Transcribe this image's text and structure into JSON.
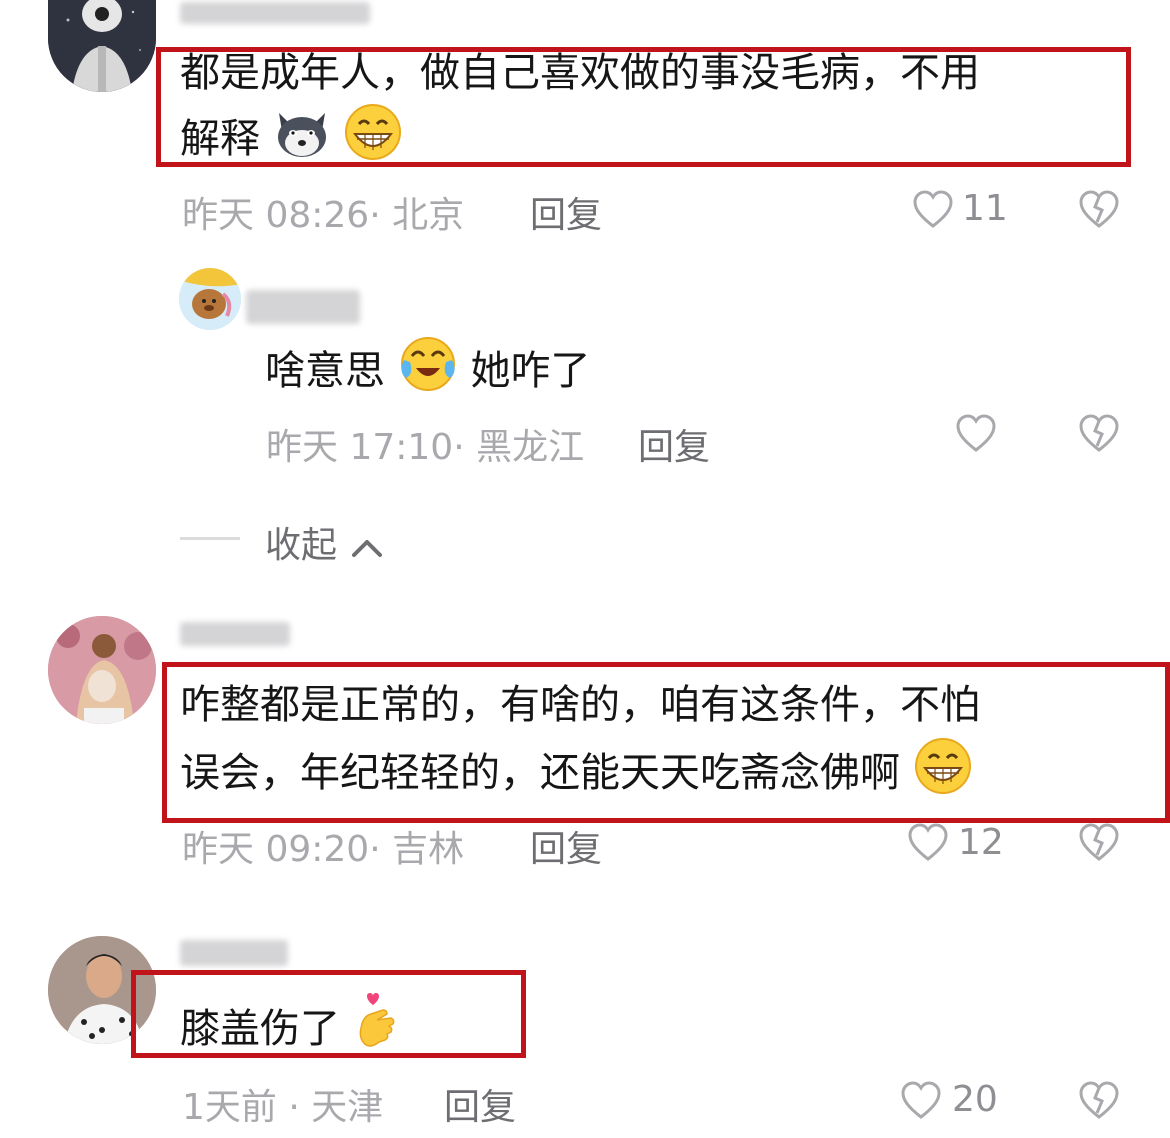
{
  "comments": [
    {
      "text_line1": "都是成年人，做自己喜欢做的事没毛病，不用",
      "text_line2": "解释",
      "time": "昨天 08:26",
      "location": "北京",
      "reply_label": "回复",
      "likes": "11",
      "emojis": [
        "husky-emoji",
        "grin-emoji"
      ]
    },
    {
      "is_reply": true,
      "text_part1": "啥意思",
      "text_part2": "她咋了",
      "time": "昨天 17:10",
      "location": "黑龙江",
      "reply_label": "回复",
      "likes": "",
      "emojis": [
        "tears-of-joy-emoji"
      ]
    },
    {
      "text_line1": "咋整都是正常的，有啥的，咱有这条件，不怕",
      "text_line2": "误会，年纪轻轻的，还能天天吃斋念佛啊",
      "time": "昨天 09:20",
      "location": "吉林",
      "reply_label": "回复",
      "likes": "12",
      "emojis": [
        "grin-emoji"
      ]
    },
    {
      "text_line1": "膝盖伤了",
      "time": "1天前",
      "location": "天津",
      "reply_label": "回复",
      "likes": "20",
      "emojis": [
        "finger-heart-emoji"
      ]
    }
  ],
  "collapse_label": "收起",
  "colors": {
    "highlight": "#c0141a",
    "meta": "#a9a9ad",
    "reply": "#6e6e72"
  }
}
